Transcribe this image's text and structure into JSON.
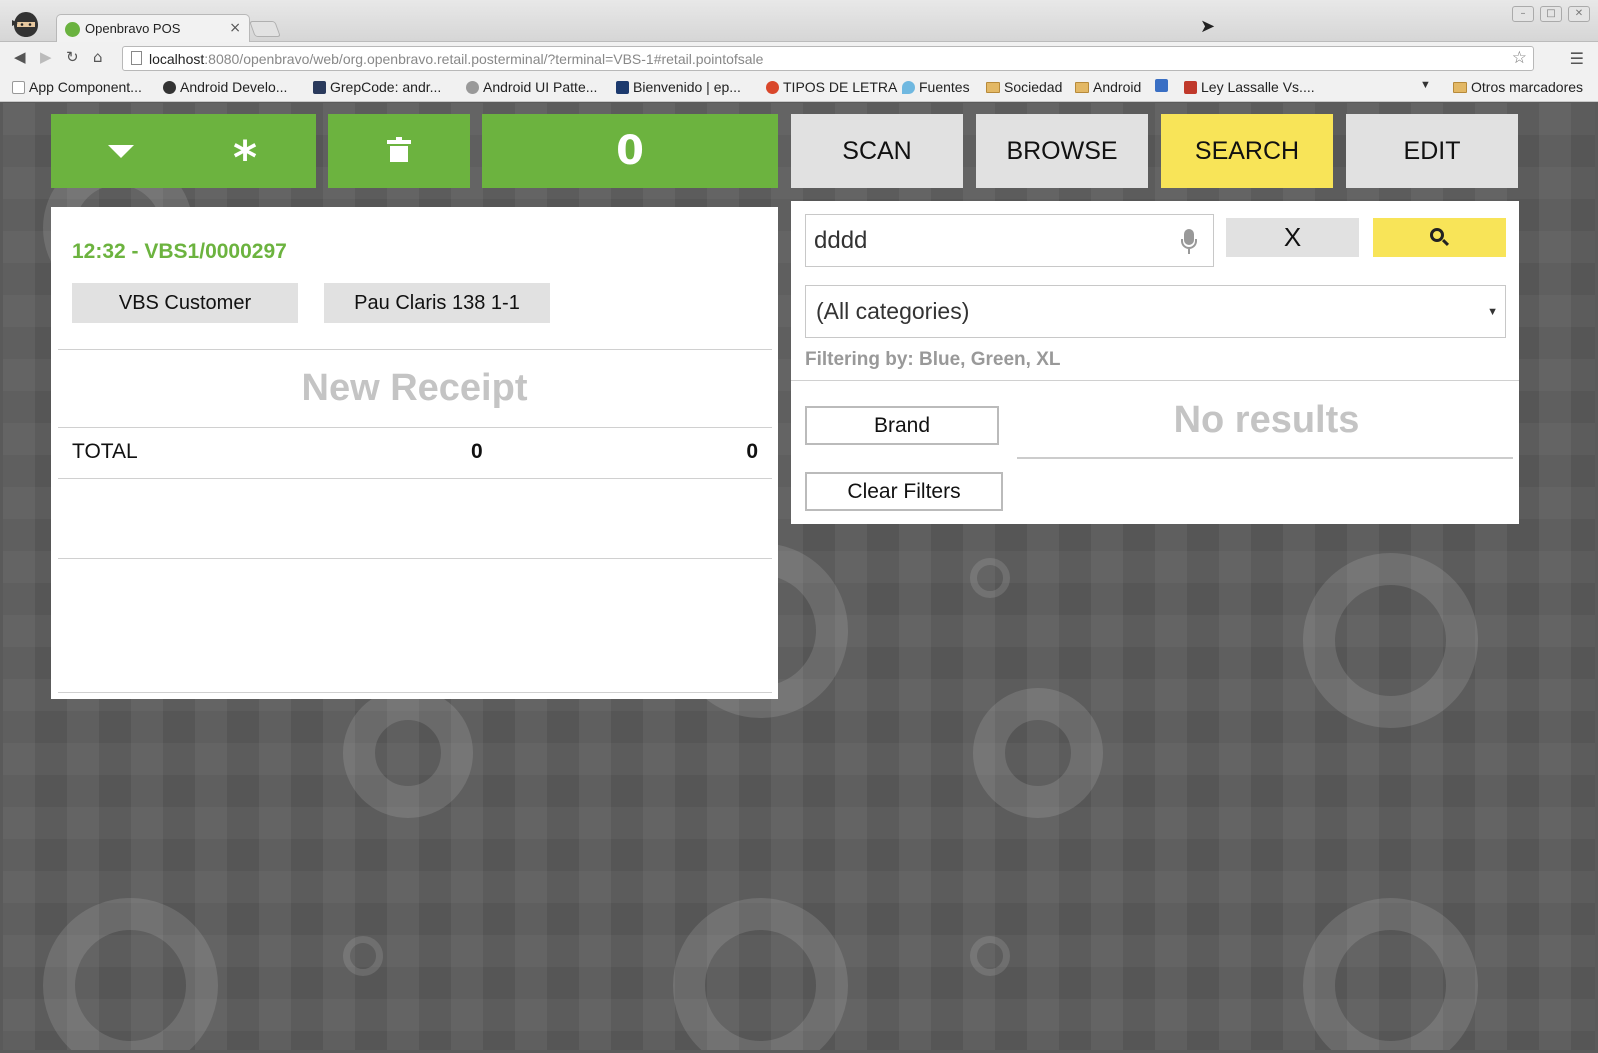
{
  "browser": {
    "tab_title": "Openbravo POS",
    "tab_close": "×",
    "url_host": "localhost",
    "url_rest": ":8080/openbravo/web/org.openbravo.retail.posterminal/?terminal=VBS-1#retail.pointofsale",
    "bookmarks": [
      {
        "label": "App Component...",
        "icon": "page-icon"
      },
      {
        "label": "Android Develo...",
        "icon": "android-icon"
      },
      {
        "label": "GrepCode: andr...",
        "icon": "grepcode-icon"
      },
      {
        "label": "Android UI Patte...",
        "icon": "pattern-icon"
      },
      {
        "label": "Bienvenido | ep...",
        "icon": "ep-icon"
      },
      {
        "label": "TIPOS DE LETRA",
        "icon": "letter-icon"
      },
      {
        "label": "Fuentes",
        "icon": "drop-icon"
      },
      {
        "label": "Sociedad",
        "icon": "folder-icon"
      },
      {
        "label": "Android",
        "icon": "folder-icon"
      },
      {
        "label": "",
        "icon": "bookmark-icon"
      },
      {
        "label": "Ley Lassalle Vs....",
        "icon": "flag-icon"
      }
    ],
    "other_bookmarks": "Otros marcadores"
  },
  "toolbar": {
    "counter": "0",
    "scan": "SCAN",
    "browse": "BROWSE",
    "search": "SEARCH",
    "edit": "EDIT",
    "active_tab_color": "#f8e458",
    "green": "#6cb33f"
  },
  "receipt": {
    "order_id": "12:32 - VBS1/0000297",
    "customer": "VBS Customer",
    "address": "Pau Claris 138 1-1",
    "empty_label": "New Receipt",
    "total_label": "TOTAL",
    "total_qty": "0",
    "total_amount": "0"
  },
  "search": {
    "query": "dddd",
    "clear_label": "X",
    "category": "(All categories)",
    "category_arrow": "▼",
    "filter_text": "Filtering by: Blue, Green, XL",
    "brand_label": "Brand",
    "clear_filters_label": "Clear Filters",
    "no_results": "No results"
  }
}
